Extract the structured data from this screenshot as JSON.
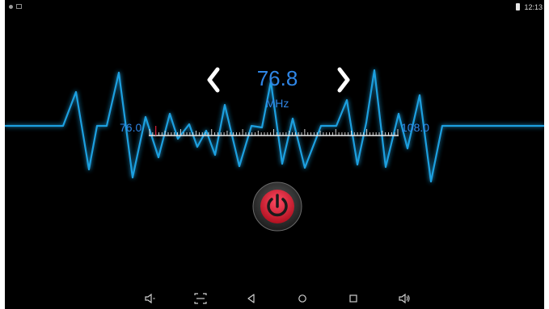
{
  "status_bar": {
    "time": "12:13",
    "icons": [
      "settings-dot-icon",
      "image-notification-icon",
      "battery-icon"
    ]
  },
  "radio": {
    "frequency": "76.8",
    "unit": "MHz",
    "scale_min": "76.0",
    "scale_max": "108.0",
    "prev_icon": "chevron-left-icon",
    "next_icon": "chevron-right-icon",
    "power_icon": "power-icon"
  },
  "nav_bar": {
    "icons": [
      "volume-down-icon",
      "screenshot-icon",
      "back-icon",
      "home-icon",
      "recents-icon",
      "volume-up-icon"
    ]
  },
  "colors": {
    "accent": "#2f86e6",
    "wave": "#1fa0e0",
    "power_red": "#e0203a",
    "background": "#000000"
  }
}
